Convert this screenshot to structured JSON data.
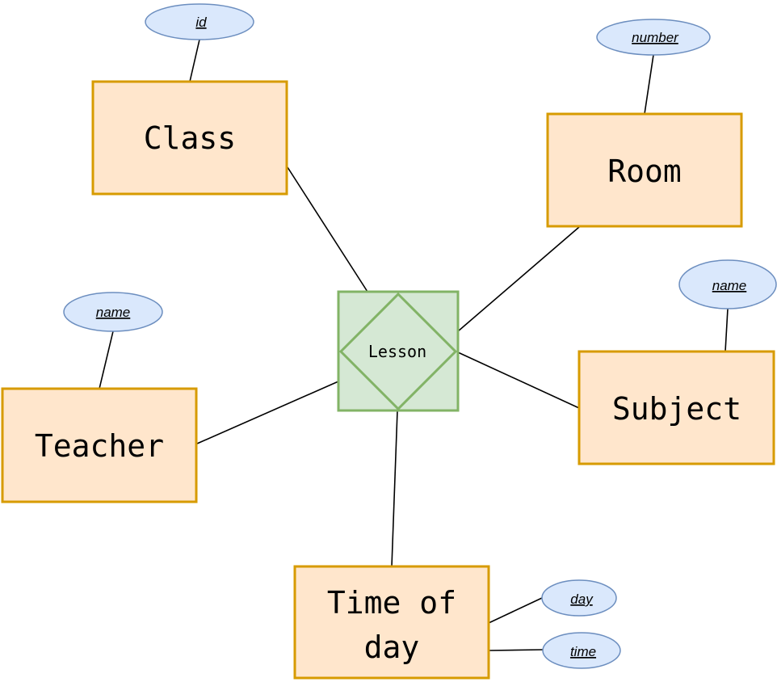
{
  "diagram": {
    "type": "entity-relationship",
    "colors": {
      "entity_fill": "#ffe6cc",
      "entity_stroke": "#d79b00",
      "attribute_fill": "#dae8fc",
      "attribute_stroke": "#6c8ebf",
      "relationship_fill": "#d5e8d4",
      "relationship_stroke": "#82b366",
      "line": "#000000"
    },
    "relationship": {
      "id": "lesson",
      "label": "Lesson"
    },
    "entities": [
      {
        "id": "class",
        "label": "Class",
        "attributes": [
          {
            "id": "class-id",
            "label": "id"
          }
        ]
      },
      {
        "id": "room",
        "label": "Room",
        "attributes": [
          {
            "id": "room-number",
            "label": "number"
          }
        ]
      },
      {
        "id": "teacher",
        "label": "Teacher",
        "attributes": [
          {
            "id": "teacher-name",
            "label": "name"
          }
        ]
      },
      {
        "id": "subject",
        "label": "Subject",
        "attributes": [
          {
            "id": "subject-name",
            "label": "name"
          }
        ]
      },
      {
        "id": "time-of-day",
        "label_lines": [
          "Time of",
          "day"
        ],
        "attributes": [
          {
            "id": "tod-day",
            "label": "day"
          },
          {
            "id": "tod-time",
            "label": "time"
          }
        ]
      }
    ]
  }
}
